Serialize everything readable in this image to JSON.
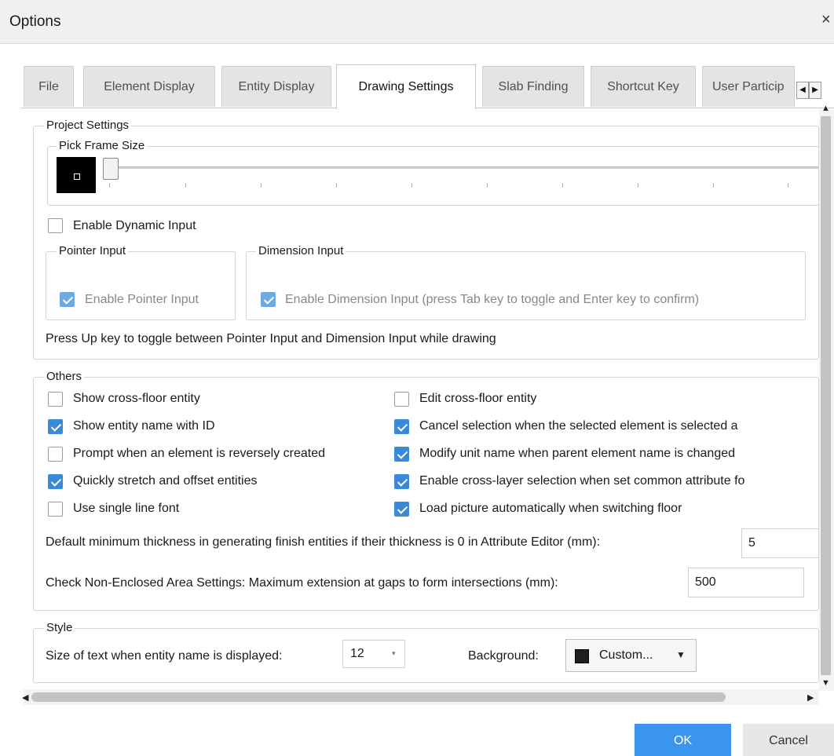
{
  "window": {
    "title": "Options",
    "close_glyph": "×"
  },
  "tabs": [
    {
      "label": "File",
      "active": false
    },
    {
      "label": "Element Display",
      "active": false
    },
    {
      "label": "Entity Display",
      "active": false
    },
    {
      "label": "Drawing Settings",
      "active": true
    },
    {
      "label": "Slab Finding",
      "active": false
    },
    {
      "label": "Shortcut Key",
      "active": false
    },
    {
      "label": "User Particip",
      "active": false
    }
  ],
  "tab_scroll": {
    "left_glyph": "◀",
    "right_glyph": "▶"
  },
  "project_settings": {
    "label": "Project Settings",
    "pick_frame": {
      "label": "Pick Frame Size",
      "slider_value": 0
    },
    "enable_dynamic_input": {
      "label": "Enable Dynamic Input",
      "checked": false
    },
    "pointer_input": {
      "label": "Pointer Input",
      "checkbox_label": "Enable Pointer Input",
      "checked": true
    },
    "dimension_input": {
      "label": "Dimension Input",
      "checkbox_label": "Enable Dimension Input (press Tab key to toggle and Enter key to confirm)",
      "checked": true
    },
    "hint": "Press Up key to toggle between Pointer Input and Dimension Input while drawing"
  },
  "others": {
    "label": "Others",
    "left": [
      {
        "label": "Show cross-floor entity",
        "checked": false
      },
      {
        "label": "Show entity name with ID",
        "checked": true
      },
      {
        "label": "Prompt when an element is reversely created",
        "checked": false
      },
      {
        "label": "Quickly stretch and offset entities",
        "checked": true
      },
      {
        "label": "Use single line font",
        "checked": false
      }
    ],
    "right": [
      {
        "label": "Edit cross-floor entity",
        "checked": false
      },
      {
        "label": "Cancel selection when the selected element is selected a",
        "checked": true
      },
      {
        "label": "Modify unit name when parent element name is changed",
        "checked": true
      },
      {
        "label": "Enable cross-layer selection when set common attribute fo",
        "checked": true
      },
      {
        "label": "Load picture automatically when switching floor",
        "checked": true
      }
    ],
    "min_thickness": {
      "label": "Default minimum thickness in generating finish entities if their thickness is 0 in Attribute Editor (mm):",
      "value": "5"
    },
    "max_extension": {
      "label": "Check Non-Enclosed Area Settings: Maximum extension at gaps to form intersections (mm):",
      "value": "500"
    }
  },
  "style": {
    "label": "Style",
    "text_size": {
      "label": "Size of text when entity name is displayed:",
      "value": "12",
      "arrow": "▾"
    },
    "background": {
      "label": "Background:",
      "value": "Custom...",
      "arrow": "▼",
      "swatch_color": "#1e1e1e"
    }
  },
  "scrollbars": {
    "up": "▲",
    "down": "▼",
    "left": "◀",
    "right": "▶"
  },
  "buttons": {
    "ok": "OK",
    "cancel": "Cancel"
  },
  "colors": {
    "accent": "#3a95ee",
    "checkbox": "#3a89d8"
  }
}
